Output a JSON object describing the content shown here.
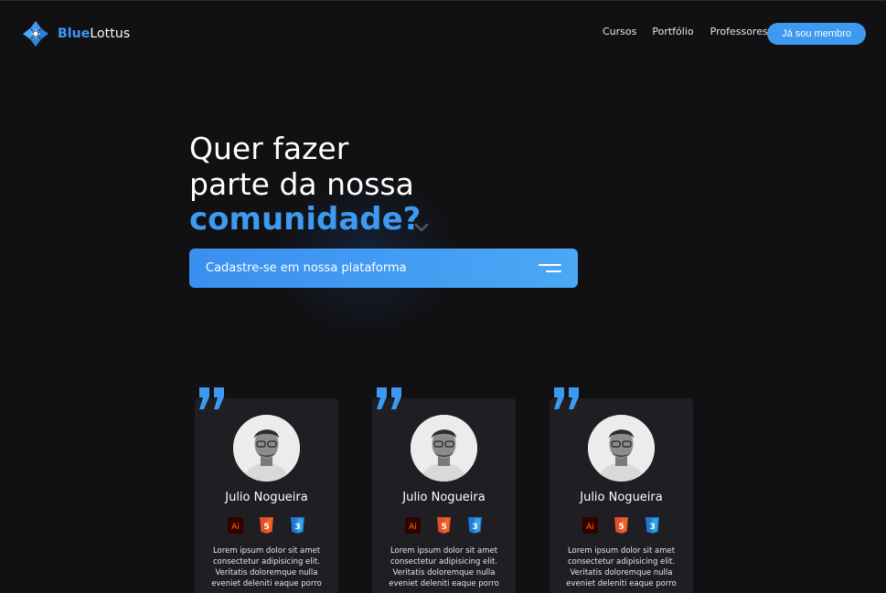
{
  "brand": {
    "name_part1": "Blue",
    "name_part2": "Lottus",
    "accent": "#3d9af0",
    "icon": "lotus-logo-icon"
  },
  "nav": {
    "items": [
      "Cursos",
      "Portfólio",
      "Professores"
    ],
    "cta": "Já sou membro"
  },
  "hero": {
    "line1": "Quer fazer",
    "line2": "parte da nossa",
    "line3": "comunidade?",
    "signup_label": "Cadastre-se em nossa plataforma"
  },
  "cards": [
    {
      "name": "Julio Nogueira",
      "skills": [
        {
          "label": "Ai",
          "icon": "illustrator-icon"
        },
        {
          "label": "5",
          "icon": "html5-icon"
        },
        {
          "label": "3",
          "icon": "css3-icon"
        }
      ],
      "bio": "Lorem ipsum dolor sit amet consectetur adipisicing elit. Veritatis doloremque nulla eveniet deleniti eaque porro"
    },
    {
      "name": "Julio Nogueira",
      "skills": [
        {
          "label": "Ai",
          "icon": "illustrator-icon"
        },
        {
          "label": "5",
          "icon": "html5-icon"
        },
        {
          "label": "3",
          "icon": "css3-icon"
        }
      ],
      "bio": "Lorem ipsum dolor sit amet consectetur adipisicing elit. Veritatis doloremque nulla eveniet deleniti eaque porro"
    },
    {
      "name": "Julio Nogueira",
      "skills": [
        {
          "label": "Ai",
          "icon": "illustrator-icon"
        },
        {
          "label": "5",
          "icon": "html5-icon"
        },
        {
          "label": "3",
          "icon": "css3-icon"
        }
      ],
      "bio": "Lorem ipsum dolor sit amet consectetur adipisicing elit. Veritatis doloremque nulla eveniet deleniti eaque porro"
    }
  ],
  "colors": {
    "background": "#111114",
    "card": "#1f1f23",
    "accent": "#3d9af0",
    "illustrator": "#ff7a00",
    "html5": "#e34f26",
    "css3": "#1f7ad6"
  }
}
